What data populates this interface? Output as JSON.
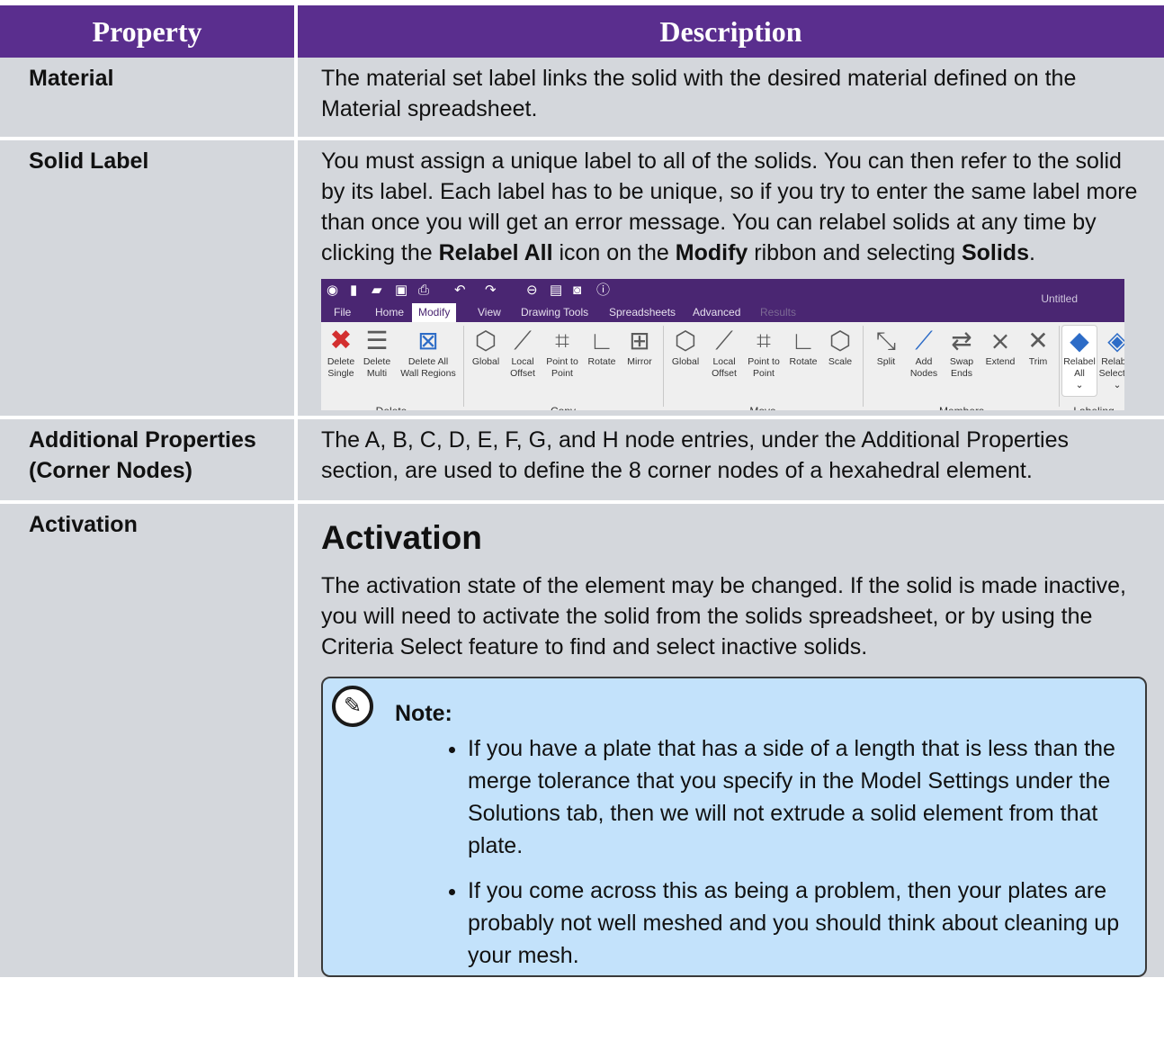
{
  "headers": {
    "property": "Property",
    "description": "Description"
  },
  "rows": {
    "material": {
      "property": "Material",
      "description": "The material set label links the solid with the desired material defined on the Material spreadsheet."
    },
    "solid_label": {
      "property": "Solid Label",
      "text_1": "You must assign a unique label to all of the solids. You can then refer to the solid by its label. Each label has to be unique, so if you try to enter the same label more than once you will get an error message. You can relabel solids at any time by clicking the ",
      "bold_1": "Relabel All",
      "text_2": " icon on the ",
      "bold_2": "Modify",
      "text_3": " ribbon and selecting ",
      "bold_3": "Solids",
      "text_4": "."
    },
    "additional": {
      "property": "Additional Properties (Corner Nodes)",
      "description": "The A, B, C, D, E, F, G, and H node entries, under the Additional Properties section, are used to define the 8 corner nodes of a hexahedral element."
    },
    "activation": {
      "property": "Activation",
      "heading": "Activation",
      "description": "The activation state of the element may be changed. If the solid is made inactive, you will need to activate the solid from the solids spreadsheet, or by using the Criteria Select feature to find and select inactive solids.",
      "note_title": "Note:",
      "note_items": [
        "If you have a plate that has a side of a length that is less than the merge tolerance that you specify in the Model Settings under the Solutions tab, then we will not extrude a solid element from that plate.",
        "If you come across this as being a problem, then your plates are probably not well meshed and you should think about cleaning up your mesh."
      ]
    }
  },
  "ribbon": {
    "window_title": "Untitled",
    "tabs": [
      "File",
      "Home",
      "Modify",
      "View",
      "Drawing Tools",
      "Spreadsheets",
      "Advanced",
      "Results"
    ],
    "active_tab": "Modify",
    "groups": {
      "delete": "Delete",
      "copy": "Copy",
      "move": "Move",
      "members": "Members",
      "labeling": "Labeling"
    },
    "tools": {
      "delete_single": [
        "Delete",
        "Single"
      ],
      "delete_multi": [
        "Delete",
        "Multi"
      ],
      "delete_all": [
        "Delete All",
        "Wall Regions"
      ],
      "copy_global": [
        "Global",
        ""
      ],
      "copy_local": [
        "Local",
        "Offset"
      ],
      "copy_p2p": [
        "Point to",
        "Point"
      ],
      "copy_rotate": [
        "Rotate",
        ""
      ],
      "copy_mirror": [
        "Mirror",
        ""
      ],
      "move_global": [
        "Global",
        ""
      ],
      "move_local": [
        "Local",
        "Offset"
      ],
      "move_p2p": [
        "Point to",
        "Point"
      ],
      "move_rotate": [
        "Rotate",
        ""
      ],
      "move_scale": [
        "Scale",
        ""
      ],
      "split": [
        "Split",
        ""
      ],
      "add_nodes": [
        "Add",
        "Nodes"
      ],
      "swap_ends": [
        "Swap",
        "Ends"
      ],
      "extend": [
        "Extend",
        ""
      ],
      "trim": [
        "Trim",
        ""
      ],
      "relabel_all": [
        "Relabel",
        "All"
      ],
      "relabel_selected": [
        "Relabel",
        "Selected"
      ]
    },
    "icons": {
      "qat": [
        "app-3d-icon",
        "new-file-icon",
        "open-folder-icon",
        "save-icon",
        "print-icon",
        "undo-icon",
        "redo-icon",
        "toggle-icon",
        "spreadsheet-icon",
        "camera-icon",
        "info-icon"
      ]
    }
  }
}
